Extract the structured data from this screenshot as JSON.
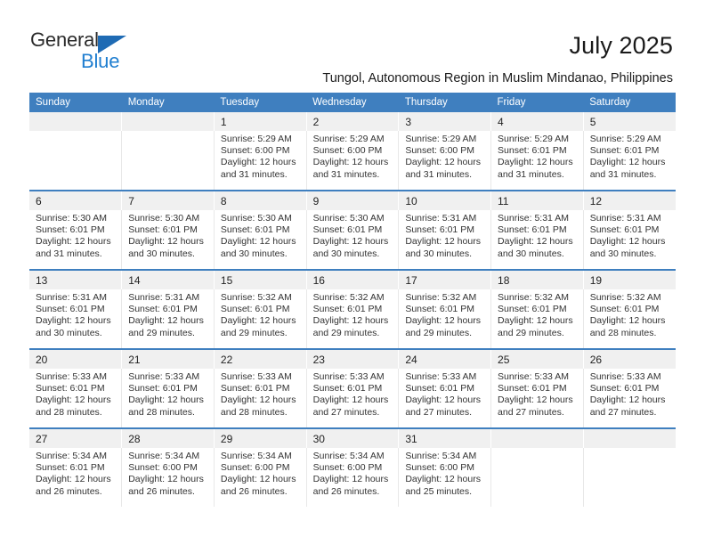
{
  "brand": {
    "name_top": "General",
    "name_bottom": "Blue",
    "triangle_color": "#1f6bb4",
    "blue_color": "#1f7ed0"
  },
  "header": {
    "month_title": "July 2025",
    "subtitle": "Tungol, Autonomous Region in Muslim Mindanao, Philippines",
    "header_bg": "#3f7fbf"
  },
  "weekday_headers": [
    "Sunday",
    "Monday",
    "Tuesday",
    "Wednesday",
    "Thursday",
    "Friday",
    "Saturday"
  ],
  "weeks": [
    {
      "days": [
        {
          "num": "",
          "lines": []
        },
        {
          "num": "",
          "lines": []
        },
        {
          "num": "1",
          "lines": [
            "Sunrise: 5:29 AM",
            "Sunset: 6:00 PM",
            "Daylight: 12 hours",
            "and 31 minutes."
          ]
        },
        {
          "num": "2",
          "lines": [
            "Sunrise: 5:29 AM",
            "Sunset: 6:00 PM",
            "Daylight: 12 hours",
            "and 31 minutes."
          ]
        },
        {
          "num": "3",
          "lines": [
            "Sunrise: 5:29 AM",
            "Sunset: 6:00 PM",
            "Daylight: 12 hours",
            "and 31 minutes."
          ]
        },
        {
          "num": "4",
          "lines": [
            "Sunrise: 5:29 AM",
            "Sunset: 6:01 PM",
            "Daylight: 12 hours",
            "and 31 minutes."
          ]
        },
        {
          "num": "5",
          "lines": [
            "Sunrise: 5:29 AM",
            "Sunset: 6:01 PM",
            "Daylight: 12 hours",
            "and 31 minutes."
          ]
        }
      ]
    },
    {
      "days": [
        {
          "num": "6",
          "lines": [
            "Sunrise: 5:30 AM",
            "Sunset: 6:01 PM",
            "Daylight: 12 hours",
            "and 31 minutes."
          ]
        },
        {
          "num": "7",
          "lines": [
            "Sunrise: 5:30 AM",
            "Sunset: 6:01 PM",
            "Daylight: 12 hours",
            "and 30 minutes."
          ]
        },
        {
          "num": "8",
          "lines": [
            "Sunrise: 5:30 AM",
            "Sunset: 6:01 PM",
            "Daylight: 12 hours",
            "and 30 minutes."
          ]
        },
        {
          "num": "9",
          "lines": [
            "Sunrise: 5:30 AM",
            "Sunset: 6:01 PM",
            "Daylight: 12 hours",
            "and 30 minutes."
          ]
        },
        {
          "num": "10",
          "lines": [
            "Sunrise: 5:31 AM",
            "Sunset: 6:01 PM",
            "Daylight: 12 hours",
            "and 30 minutes."
          ]
        },
        {
          "num": "11",
          "lines": [
            "Sunrise: 5:31 AM",
            "Sunset: 6:01 PM",
            "Daylight: 12 hours",
            "and 30 minutes."
          ]
        },
        {
          "num": "12",
          "lines": [
            "Sunrise: 5:31 AM",
            "Sunset: 6:01 PM",
            "Daylight: 12 hours",
            "and 30 minutes."
          ]
        }
      ]
    },
    {
      "days": [
        {
          "num": "13",
          "lines": [
            "Sunrise: 5:31 AM",
            "Sunset: 6:01 PM",
            "Daylight: 12 hours",
            "and 30 minutes."
          ]
        },
        {
          "num": "14",
          "lines": [
            "Sunrise: 5:31 AM",
            "Sunset: 6:01 PM",
            "Daylight: 12 hours",
            "and 29 minutes."
          ]
        },
        {
          "num": "15",
          "lines": [
            "Sunrise: 5:32 AM",
            "Sunset: 6:01 PM",
            "Daylight: 12 hours",
            "and 29 minutes."
          ]
        },
        {
          "num": "16",
          "lines": [
            "Sunrise: 5:32 AM",
            "Sunset: 6:01 PM",
            "Daylight: 12 hours",
            "and 29 minutes."
          ]
        },
        {
          "num": "17",
          "lines": [
            "Sunrise: 5:32 AM",
            "Sunset: 6:01 PM",
            "Daylight: 12 hours",
            "and 29 minutes."
          ]
        },
        {
          "num": "18",
          "lines": [
            "Sunrise: 5:32 AM",
            "Sunset: 6:01 PM",
            "Daylight: 12 hours",
            "and 29 minutes."
          ]
        },
        {
          "num": "19",
          "lines": [
            "Sunrise: 5:32 AM",
            "Sunset: 6:01 PM",
            "Daylight: 12 hours",
            "and 28 minutes."
          ]
        }
      ]
    },
    {
      "days": [
        {
          "num": "20",
          "lines": [
            "Sunrise: 5:33 AM",
            "Sunset: 6:01 PM",
            "Daylight: 12 hours",
            "and 28 minutes."
          ]
        },
        {
          "num": "21",
          "lines": [
            "Sunrise: 5:33 AM",
            "Sunset: 6:01 PM",
            "Daylight: 12 hours",
            "and 28 minutes."
          ]
        },
        {
          "num": "22",
          "lines": [
            "Sunrise: 5:33 AM",
            "Sunset: 6:01 PM",
            "Daylight: 12 hours",
            "and 28 minutes."
          ]
        },
        {
          "num": "23",
          "lines": [
            "Sunrise: 5:33 AM",
            "Sunset: 6:01 PM",
            "Daylight: 12 hours",
            "and 27 minutes."
          ]
        },
        {
          "num": "24",
          "lines": [
            "Sunrise: 5:33 AM",
            "Sunset: 6:01 PM",
            "Daylight: 12 hours",
            "and 27 minutes."
          ]
        },
        {
          "num": "25",
          "lines": [
            "Sunrise: 5:33 AM",
            "Sunset: 6:01 PM",
            "Daylight: 12 hours",
            "and 27 minutes."
          ]
        },
        {
          "num": "26",
          "lines": [
            "Sunrise: 5:33 AM",
            "Sunset: 6:01 PM",
            "Daylight: 12 hours",
            "and 27 minutes."
          ]
        }
      ]
    },
    {
      "days": [
        {
          "num": "27",
          "lines": [
            "Sunrise: 5:34 AM",
            "Sunset: 6:01 PM",
            "Daylight: 12 hours",
            "and 26 minutes."
          ]
        },
        {
          "num": "28",
          "lines": [
            "Sunrise: 5:34 AM",
            "Sunset: 6:00 PM",
            "Daylight: 12 hours",
            "and 26 minutes."
          ]
        },
        {
          "num": "29",
          "lines": [
            "Sunrise: 5:34 AM",
            "Sunset: 6:00 PM",
            "Daylight: 12 hours",
            "and 26 minutes."
          ]
        },
        {
          "num": "30",
          "lines": [
            "Sunrise: 5:34 AM",
            "Sunset: 6:00 PM",
            "Daylight: 12 hours",
            "and 26 minutes."
          ]
        },
        {
          "num": "31",
          "lines": [
            "Sunrise: 5:34 AM",
            "Sunset: 6:00 PM",
            "Daylight: 12 hours",
            "and 25 minutes."
          ]
        },
        {
          "num": "",
          "lines": []
        },
        {
          "num": "",
          "lines": []
        }
      ]
    }
  ]
}
